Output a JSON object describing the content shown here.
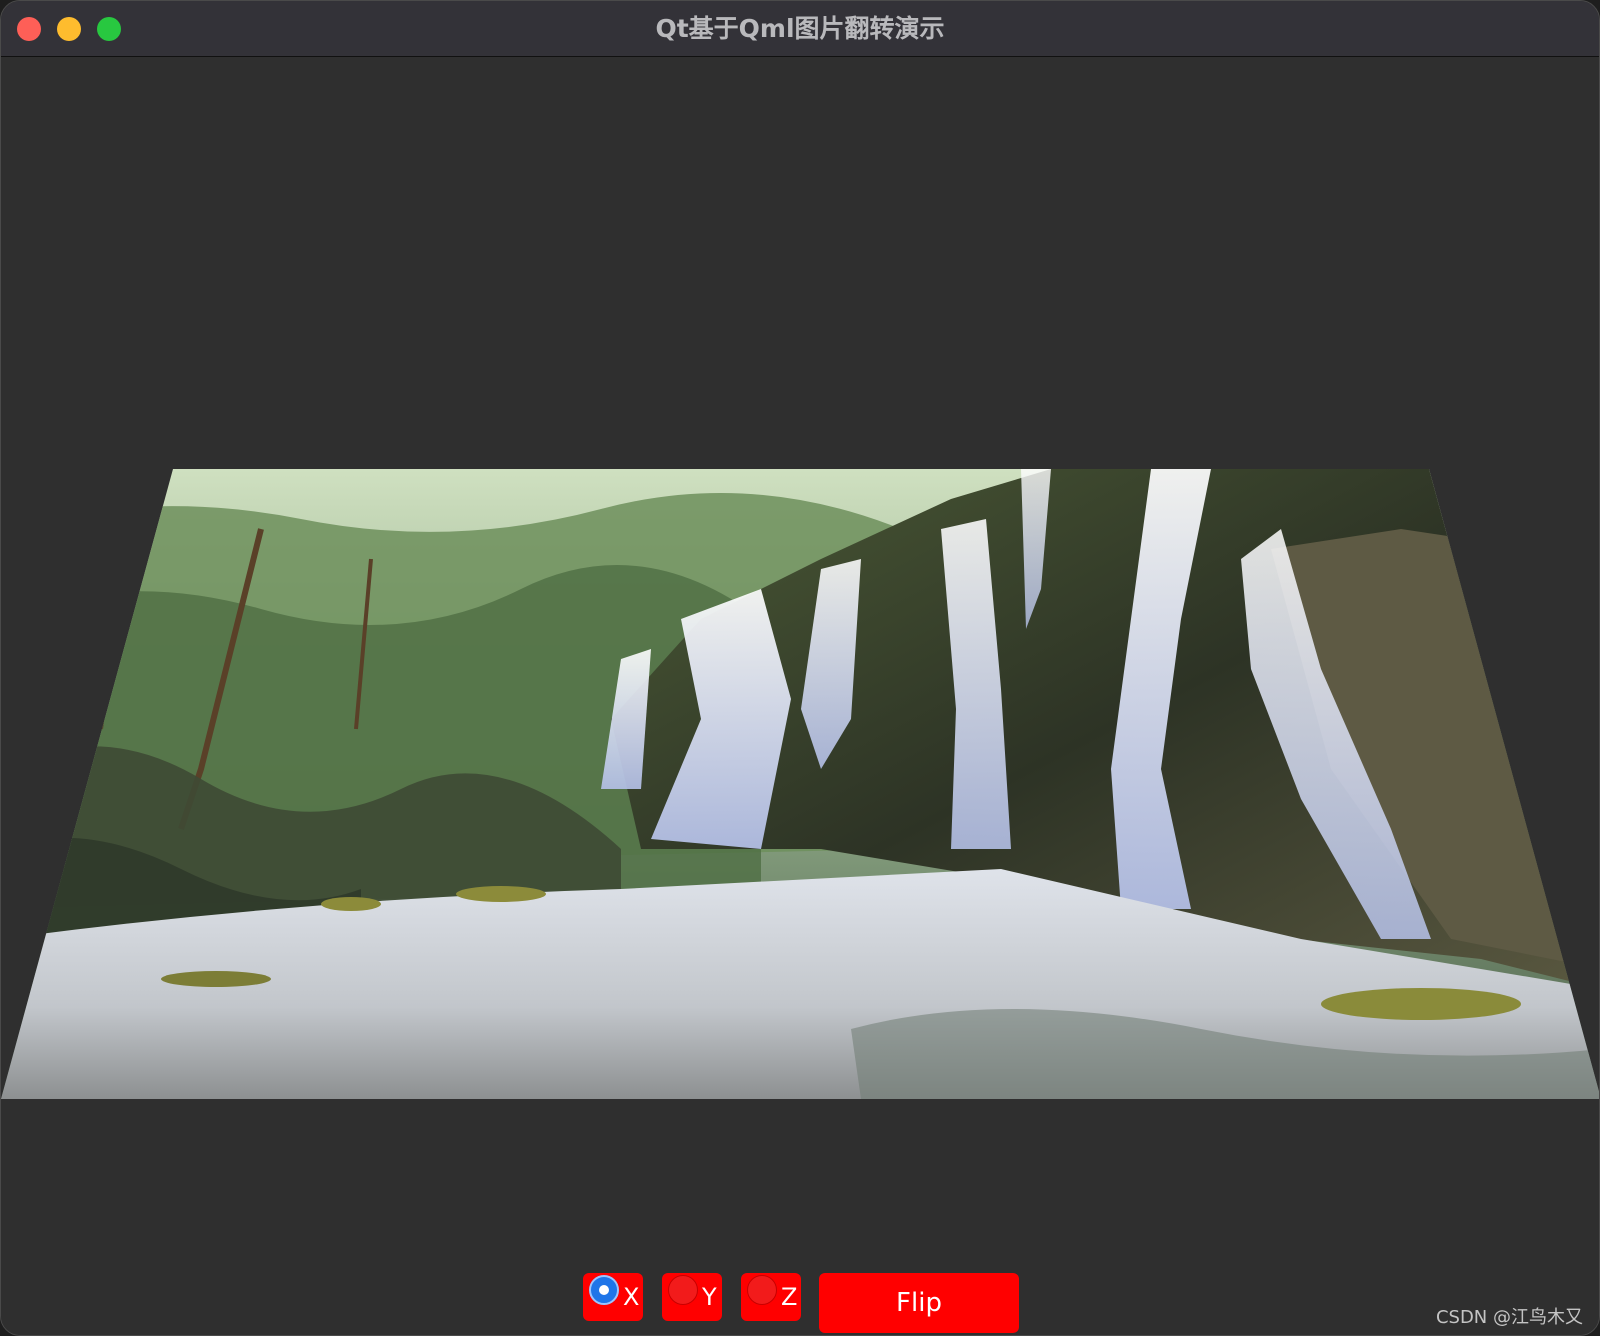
{
  "window": {
    "title": "Qt基于Qml图片翻转演示"
  },
  "controls": {
    "axes": [
      {
        "label": "X",
        "checked": true
      },
      {
        "label": "Y",
        "checked": false
      },
      {
        "label": "Z",
        "checked": false
      }
    ],
    "flip_label": "Flip"
  },
  "watermark": "CSDN @江鸟木又",
  "colors": {
    "accent": "#ff0000",
    "window_bg": "#2f2f2f",
    "titlebar_bg": "#333238",
    "radio_checked": "#1f75e8"
  },
  "image": {
    "description_icon": "waterfall-photo"
  }
}
